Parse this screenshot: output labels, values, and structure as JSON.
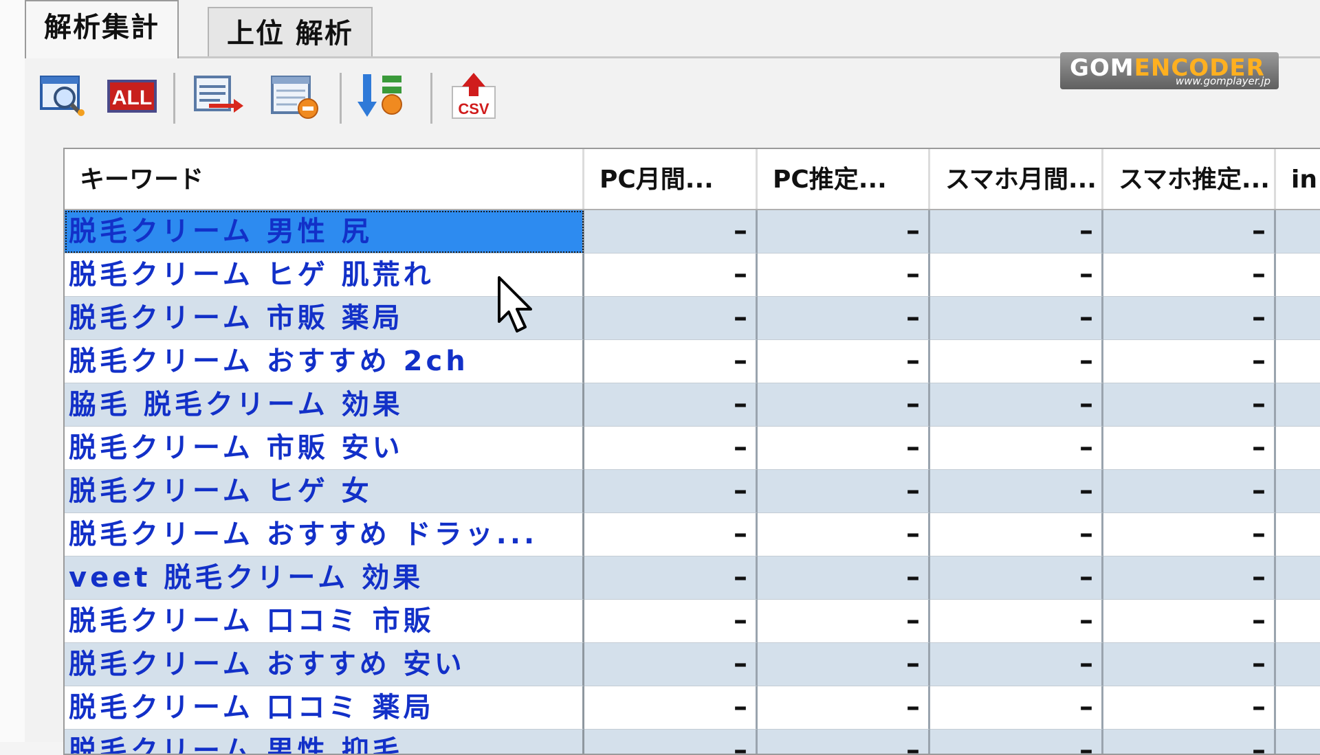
{
  "tabs": [
    {
      "label": "解析集計",
      "active": true
    },
    {
      "label": "上位 解析",
      "active": false
    }
  ],
  "toolbar": {
    "icons": [
      "search-window-icon",
      "all-icon",
      "export-list-icon",
      "delete-list-icon",
      "sort-icon",
      "csv-upload-icon"
    ],
    "all_label": "ALL",
    "csv_label": "CSV"
  },
  "watermark": {
    "brand_part1": "GOM",
    "brand_part2": "ENCODER",
    "url": "www.gomplayer.jp"
  },
  "table": {
    "columns": [
      "キーワード",
      "PC月間...",
      "PC推定...",
      "スマホ月間...",
      "スマホ推定...",
      "in"
    ],
    "rows": [
      {
        "keyword": "脱毛クリーム 男性 尻",
        "values": [
          "–",
          "–",
          "–",
          "–"
        ]
      },
      {
        "keyword": "脱毛クリーム ヒゲ 肌荒れ",
        "values": [
          "–",
          "–",
          "–",
          "–"
        ]
      },
      {
        "keyword": "脱毛クリーム 市販 薬局",
        "values": [
          "–",
          "–",
          "–",
          "–"
        ]
      },
      {
        "keyword": "脱毛クリーム おすすめ 2ch",
        "values": [
          "–",
          "–",
          "–",
          "–"
        ]
      },
      {
        "keyword": "脇毛 脱毛クリーム 効果",
        "values": [
          "–",
          "–",
          "–",
          "–"
        ]
      },
      {
        "keyword": "脱毛クリーム 市販 安い",
        "values": [
          "–",
          "–",
          "–",
          "–"
        ]
      },
      {
        "keyword": "脱毛クリーム ヒゲ 女",
        "values": [
          "–",
          "–",
          "–",
          "–"
        ]
      },
      {
        "keyword": "脱毛クリーム おすすめ ドラッ...",
        "values": [
          "–",
          "–",
          "–",
          "–"
        ]
      },
      {
        "keyword": "veet 脱毛クリーム 効果",
        "values": [
          "–",
          "–",
          "–",
          "–"
        ]
      },
      {
        "keyword": "脱毛クリーム 口コミ 市販",
        "values": [
          "–",
          "–",
          "–",
          "–"
        ]
      },
      {
        "keyword": "脱毛クリーム おすすめ 安い",
        "values": [
          "–",
          "–",
          "–",
          "–"
        ]
      },
      {
        "keyword": "脱毛クリーム 口コミ 薬局",
        "values": [
          "–",
          "–",
          "–",
          "–"
        ]
      },
      {
        "keyword": "脱毛クリーム 男性 抑毛",
        "values": [
          "–",
          "–",
          "–",
          "–"
        ]
      }
    ]
  },
  "colors": {
    "selected_row": "#2d8bf0",
    "alt_row": "#d4e0eb",
    "keyword_text": "#1230c8"
  }
}
